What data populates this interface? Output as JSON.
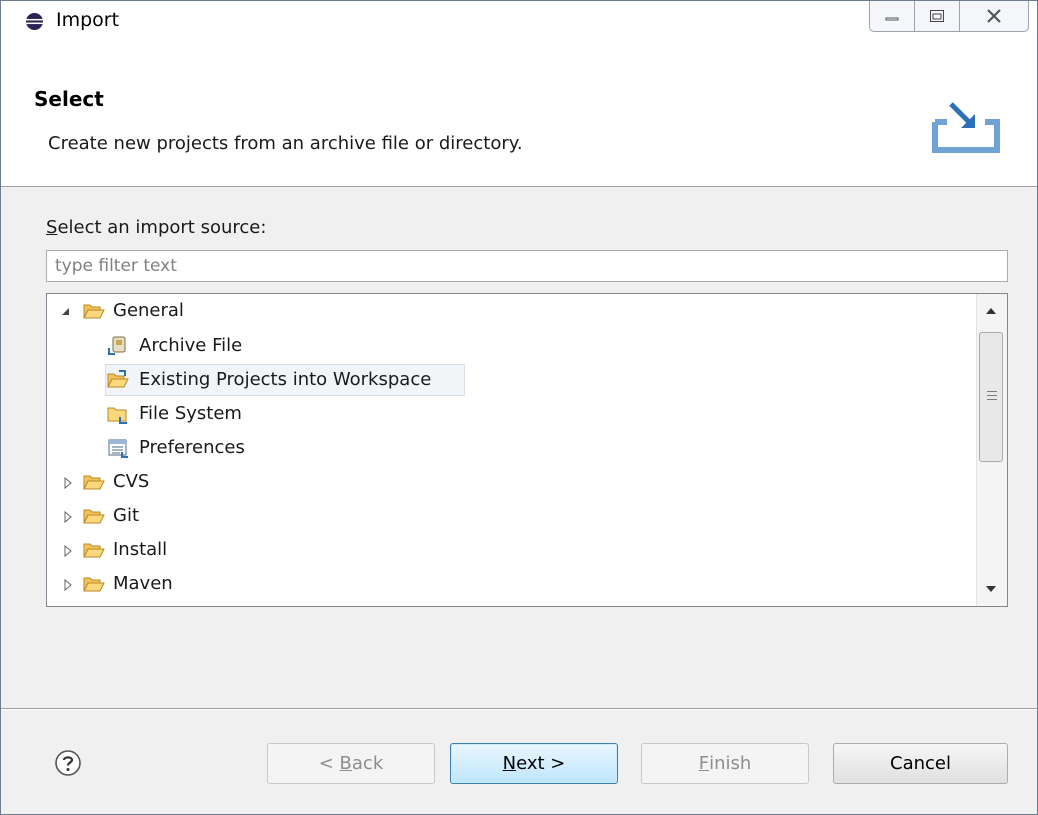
{
  "window": {
    "title": "Import",
    "app_icon": "eclipse-icon"
  },
  "header": {
    "title": "Select",
    "description": "Create new projects from an archive file or directory.",
    "icon": "import-wizard-icon"
  },
  "source": {
    "label_prefix": "S",
    "label_rest": "elect an import source:",
    "filter_placeholder": "type filter text",
    "filter_value": ""
  },
  "tree": {
    "items": [
      {
        "label": "General",
        "expanded": true,
        "icon": "folder-open-icon"
      },
      {
        "label": "Archive File",
        "icon": "archive-file-icon"
      },
      {
        "label": "Existing Projects into Workspace",
        "icon": "existing-projects-icon",
        "selected": true
      },
      {
        "label": "File System",
        "icon": "file-system-icon"
      },
      {
        "label": "Preferences",
        "icon": "preferences-icon"
      },
      {
        "label": "CVS",
        "expanded": false,
        "icon": "folder-icon"
      },
      {
        "label": "Git",
        "expanded": false,
        "icon": "folder-icon"
      },
      {
        "label": "Install",
        "expanded": false,
        "icon": "folder-icon"
      },
      {
        "label": "Maven",
        "expanded": false,
        "icon": "folder-icon"
      }
    ]
  },
  "buttons": {
    "back_prefix": "< ",
    "back_key": "B",
    "back_rest": "ack",
    "next_key": "N",
    "next_rest": "ext >",
    "finish_key": "F",
    "finish_rest": "inish",
    "cancel": "Cancel"
  },
  "colors": {
    "selection_bg": "#f2f5f8",
    "default_button_border": "#3c7fb1"
  }
}
